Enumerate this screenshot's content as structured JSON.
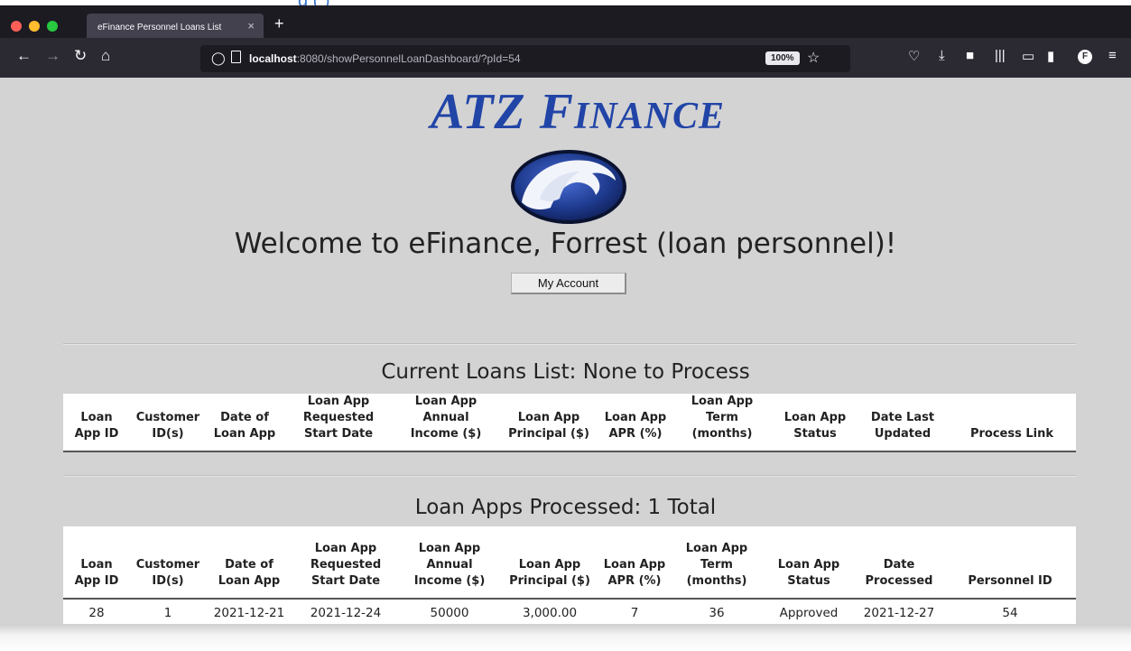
{
  "browser": {
    "tab_title": "eFinance Personnel Loans List",
    "tab_close": "×",
    "new_tab": "+",
    "url_host": "localhost",
    "url_path": ":8080/showPersonnelLoanDashboard/?pId=54",
    "zoom": "100%",
    "profile_initial": "F",
    "traffic_colors": [
      "#ff5f57",
      "#febc2e",
      "#28c840"
    ]
  },
  "header": {
    "logo_first": "ATZ F",
    "logo_rest": "INANCE",
    "welcome": "Welcome to eFinance, Forrest (loan personnel)!",
    "account_button": "My Account"
  },
  "current_loans": {
    "title": "Current Loans List: None to Process",
    "columns": [
      "Loan App ID",
      "Customer ID(s)",
      "Date of Loan App",
      "Loan App Requested Start Date",
      "Loan App Annual Income ($)",
      "Loan App Principal ($)",
      "Loan App APR (%)",
      "Loan App Term (months)",
      "Loan App Status",
      "Date Last Updated",
      "Process Link"
    ]
  },
  "processed_loans": {
    "title": "Loan Apps Processed: 1 Total",
    "columns": [
      "Loan App ID",
      "Customer ID(s)",
      "Date of Loan App",
      "Loan App Requested Start Date",
      "Loan App Annual Income ($)",
      "Loan App Principal ($)",
      "Loan App APR (%)",
      "Loan App Term (months)",
      "Loan App Status",
      "Date Processed",
      "Personnel ID"
    ],
    "rows": [
      [
        "28",
        "1",
        "2021-12-21",
        "2021-12-24",
        "50000",
        "3,000.00",
        "7",
        "36",
        "Approved",
        "2021-12-27",
        "54"
      ]
    ]
  },
  "colors": {
    "page_background": "#d3d3d3",
    "logo_blue": "#2144a7"
  }
}
